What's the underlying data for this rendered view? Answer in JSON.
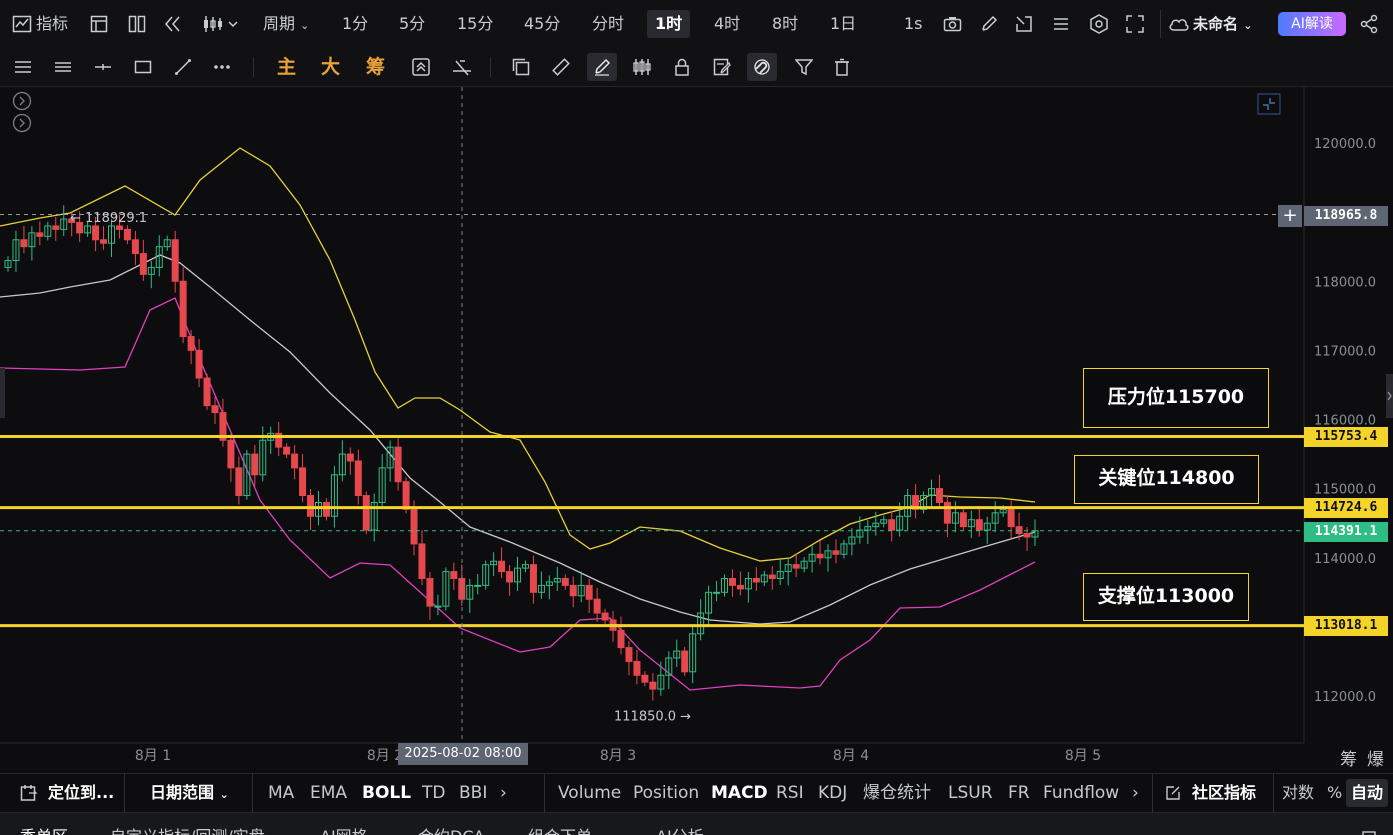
{
  "toolbar": {
    "indicator_label": "指标",
    "period_label": "周期",
    "intervals": [
      "1分",
      "5分",
      "15分",
      "45分",
      "分时",
      "1时",
      "4时",
      "8时",
      "1日",
      "1s"
    ],
    "active_interval": "1时",
    "layout_name": "未命名",
    "ai_button": "AI解读"
  },
  "drawing_toolbar": {
    "main_label": "主",
    "big_label": "大",
    "chip_label": "筹"
  },
  "chart": {
    "high_marker": "← 118929.1",
    "low_marker": "111850.0 →",
    "crosshair_time": "2025-08-02 08:00",
    "crosshair_price": "118965.8",
    "current_price": "114391.1",
    "x_labels": [
      "8月 1",
      "8月 2",
      "8月 3",
      "8月 4",
      "8月 5"
    ],
    "y_labels": [
      "120000.0",
      "118000.0",
      "117000.0",
      "116000.0",
      "115000.0",
      "114000.0",
      "112000.0"
    ],
    "h_lines": [
      {
        "price": "115753.4",
        "color": "#f5d42a"
      },
      {
        "price": "114724.6",
        "color": "#f5d42a"
      },
      {
        "price": "113018.1",
        "color": "#f5d42a"
      }
    ],
    "annotations": [
      "压力位115700",
      "关键位114800",
      "支撑位113000"
    ],
    "right_corner_labels": [
      "筹",
      "爆"
    ]
  },
  "bottom_bar": {
    "locate_label": "定位到...",
    "date_range_label": "日期范围",
    "main_indicators": [
      "MA",
      "EMA",
      "BOLL",
      "TD",
      "BBI"
    ],
    "active_main": "BOLL",
    "sub_indicators": [
      "Volume",
      "Position",
      "MACD",
      "RSI",
      "KDJ",
      "爆仓统计",
      "LSUR",
      "FR",
      "Fundflow"
    ],
    "active_sub": "MACD",
    "community_label": "社区指标",
    "log_label": "对数",
    "percent_label": "%",
    "auto_label": "自动"
  },
  "tabs": [
    "委单区",
    "自定义指标/回测/实盘",
    "AI网格",
    "合约DCA",
    "组合下单",
    "AI分析"
  ],
  "colors": {
    "up": "#2ebd85",
    "down": "#e5484d",
    "level": "#f5d42a",
    "boll_upper": "#e6d13a",
    "boll_mid": "#c8c8c8",
    "boll_lower": "#e040c0",
    "current_tag": "#2ebd85"
  }
}
